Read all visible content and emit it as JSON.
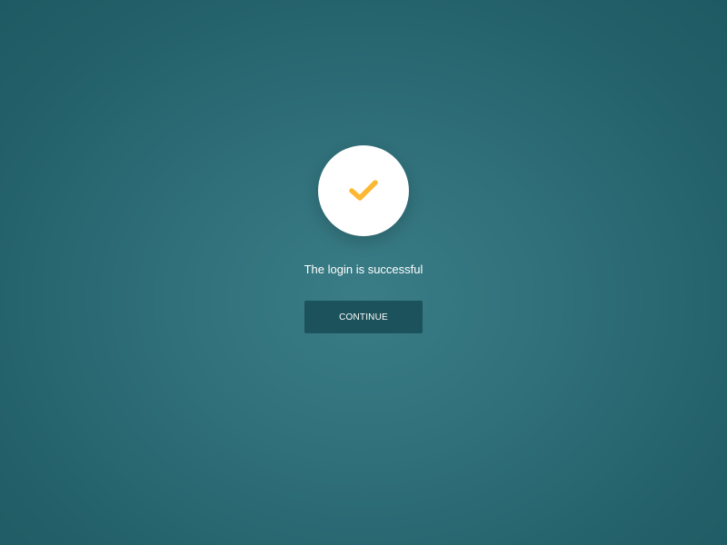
{
  "success": {
    "icon": "check-icon",
    "icon_color": "#FDB833",
    "message": "The login is successful",
    "continue_label": "CONTINUE"
  },
  "colors": {
    "background": "#2F6F79",
    "button": "#1C525B"
  }
}
